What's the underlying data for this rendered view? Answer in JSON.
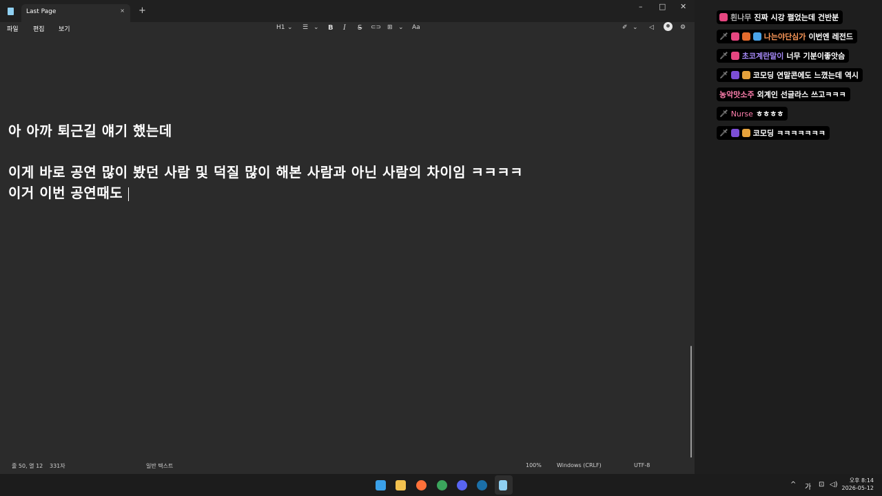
{
  "window": {
    "tab_title": "Last Page",
    "tab_close": "×",
    "tab_add": "+",
    "minimize": "–",
    "maximize": "□",
    "close": "✕"
  },
  "menu": {
    "file": "파일",
    "edit": "편집",
    "view": "보기"
  },
  "toolbar": {
    "heading": "H1",
    "heading_caret": "⌄",
    "list": "☰",
    "list_caret": "⌄",
    "bold": "B",
    "italic": "I",
    "strike": "S",
    "link": "⊂⊃",
    "table": "⊞",
    "table_caret": "⌄",
    "clear": "Aa",
    "spell": "✐",
    "spell_caret": "⌄",
    "copilot": "◁",
    "settings": "⚙"
  },
  "document": {
    "line1": "아 아까 퇴근길 얘기 했는데",
    "line2": "이게 바로 공연 많이 봤던 사람 및 덕질 많이 해본 사람과 아닌 사람의 차이임 ㅋㅋㅋㅋ",
    "line3": "이거 이번 공연때도"
  },
  "status": {
    "position": "줄 50, 열 12",
    "chars": "331자",
    "format": "일반 텍스트",
    "zoom": "100%",
    "line_ending": "Windows (CRLF)",
    "encoding": "UTF-8"
  },
  "chat": [
    {
      "badges": [
        "heart"
      ],
      "nick": "흰나무",
      "nick_color": "#b0b0b0",
      "text": "진짜 시강 쩔었는데 건반분"
    },
    {
      "badges": [
        "sword",
        "heart",
        "fire",
        "wave"
      ],
      "nick": "나는야단심가",
      "nick_color": "#ff9a5a",
      "text": "이번엔 레전드"
    },
    {
      "badges": [
        "sword",
        "heart"
      ],
      "nick": "초코계란말이",
      "nick_color": "#a78bfa",
      "text": "너무 기분이좋앗슴"
    },
    {
      "badges": [
        "sword",
        "purple",
        "face"
      ],
      "nick": "코모딩",
      "nick_color": "#ffffff",
      "text": "연말콘에도 느꼈는데 역시"
    },
    {
      "badges": [],
      "nick": "농악맛소주",
      "nick_color": "#ff7fae",
      "text": "외계인 선글라스 쓰고ㅋㅋㅋ"
    },
    {
      "badges": [
        "sword"
      ],
      "nick": "Nurse",
      "nick_color": "#ff7fae",
      "text": "ㅎㅎㅎㅎ"
    },
    {
      "badges": [
        "sword",
        "purple",
        "face"
      ],
      "nick": "코모딩",
      "nick_color": "#ffffff",
      "text": "ㅋㅋㅋㅋㅋㅋㅋ"
    }
  ],
  "taskbar": {
    "tray_up": "^",
    "ime": "가",
    "network": "⊡",
    "volume": "◁)",
    "time": "오후 8:14",
    "date": "2026-05-12",
    "icons": [
      "windows-icon",
      "file-explorer-icon",
      "firefox-icon",
      "chrome-icon",
      "discord-icon",
      "steam-icon",
      "notepad-icon"
    ]
  },
  "colors": {
    "editor_bg": "#2b2b2b",
    "titlebar_bg": "#202020",
    "taskbar_bg": "#1c1c1c"
  }
}
